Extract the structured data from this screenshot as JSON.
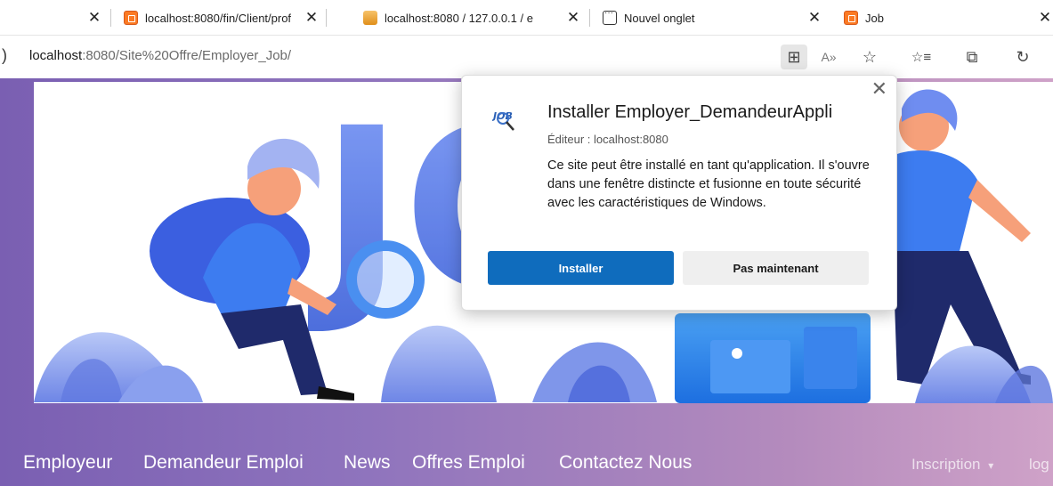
{
  "browser": {
    "tabs": [
      {
        "label": "localhost:8080/fin/Client/prof",
        "icon": "xampp-icon"
      },
      {
        "label": "localhost:8080 / 127.0.0.1 / e",
        "icon": "phpmyadmin-icon"
      },
      {
        "label": "Nouvel onglet",
        "icon": "new-tab-icon"
      },
      {
        "label": "Job",
        "icon": "xampp-icon"
      }
    ],
    "address": {
      "host": "localhost",
      "path": ":8080/Site%20Offre/Employer_Job/"
    },
    "toolbar": {
      "app_available": "⊞",
      "read_aloud": "A»",
      "add_favorite": "☆",
      "favorites": "☆≡",
      "collections": "⧉",
      "history": "↻"
    }
  },
  "install_dialog": {
    "title": "Installer Employer_DemandeurAppli",
    "publisher": "Éditeur : localhost:8080",
    "description": "Ce site peut être installé en tant qu'application. Il s'ouvre dans une fenêtre distincte et fusionne en toute sécurité avec les caractéristiques de Windows.",
    "install_label": "Installer",
    "later_label": "Pas maintenant"
  },
  "site": {
    "hero_text": "JO",
    "nav": [
      "Employeur",
      "Demandeur Emploi",
      "News",
      "Offres Emploi",
      "Contactez Nous"
    ],
    "nav_right": {
      "signup": "Inscription",
      "caret": "▾",
      "login": "log"
    }
  },
  "colors": {
    "accent": "#0f6cbd",
    "nav_gradient_start": "#7a5fb2",
    "nav_gradient_end": "#cfa2c8",
    "illustration_blue": "#3d6be5"
  }
}
